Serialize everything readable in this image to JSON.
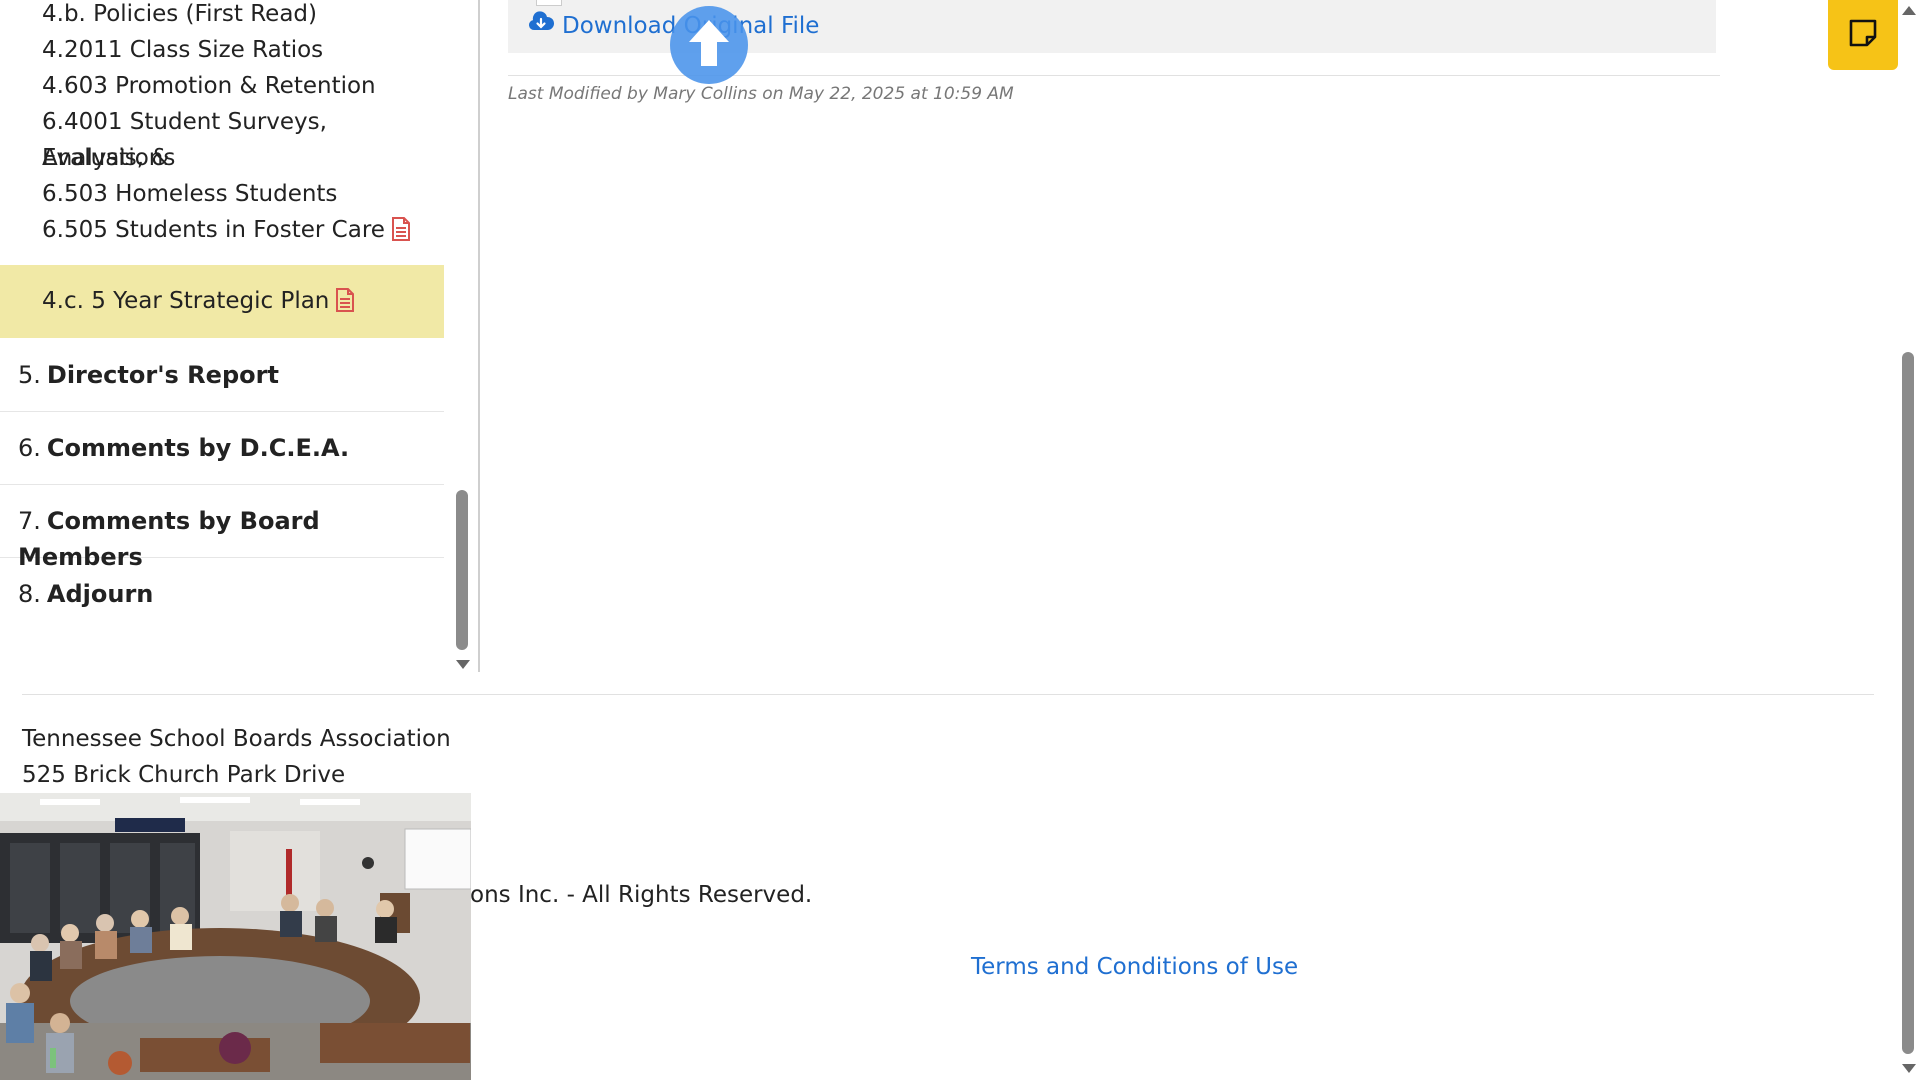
{
  "agenda": {
    "sub_items": [
      {
        "label": "4.b. Policies (First Read)"
      },
      {
        "label": "4.2011 Class Size Ratios"
      },
      {
        "label": "4.603 Promotion & Retention"
      },
      {
        "label": "6.4001 Student Surveys, Analysis, &"
      },
      {
        "label": "Evaluations"
      },
      {
        "label": "6.503 Homeless Students"
      },
      {
        "label": "6.505 Students in Foster Care"
      }
    ],
    "active_item": {
      "label": "4.c. 5 Year Strategic Plan"
    },
    "items": [
      {
        "number": "5.",
        "title": "Director's Report"
      },
      {
        "number": "6.",
        "title": "Comments by D.C.E.A."
      },
      {
        "number": "7.",
        "title": "Comments by Board Members"
      },
      {
        "number": "8.",
        "title": "Adjourn"
      }
    ]
  },
  "content": {
    "download_label": "Download Original File",
    "last_modified": "Last Modified by Mary Collins on May 22, 2025 at 10:59 AM"
  },
  "footer": {
    "org_name": "Tennessee School Boards Association",
    "address": "525 Brick Church Park Drive",
    "copyright_visible": "ons Inc. - All Rights Reserved.",
    "terms_label": "Terms and Conditions of Use"
  },
  "colors": {
    "accent_link": "#1f6fd1",
    "active_row": "#f1e9a6",
    "sticky_button": "#f6c317",
    "doc_icon": "#d9534f"
  },
  "icons": {
    "download": "cloud-download-icon",
    "document": "file-text-icon",
    "upload_overlay": "arrow-up-icon",
    "sticky_note": "sticky-note-icon"
  }
}
